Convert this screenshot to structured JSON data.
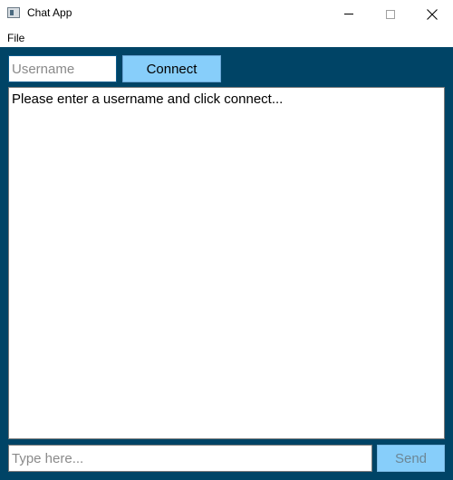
{
  "window": {
    "title": "Chat App",
    "icon": "app-window-icon"
  },
  "menu": {
    "items": [
      {
        "label": "File"
      }
    ]
  },
  "connection": {
    "username_value": "",
    "username_placeholder": "Username",
    "connect_label": "Connect"
  },
  "chat": {
    "log_text": "Please enter a username and click connect..."
  },
  "compose": {
    "message_value": "",
    "message_placeholder": "Type here...",
    "send_label": "Send",
    "send_enabled": false
  },
  "colors": {
    "background": "#004466",
    "button": "#87cefa",
    "disabled_text": "#6c8796"
  }
}
